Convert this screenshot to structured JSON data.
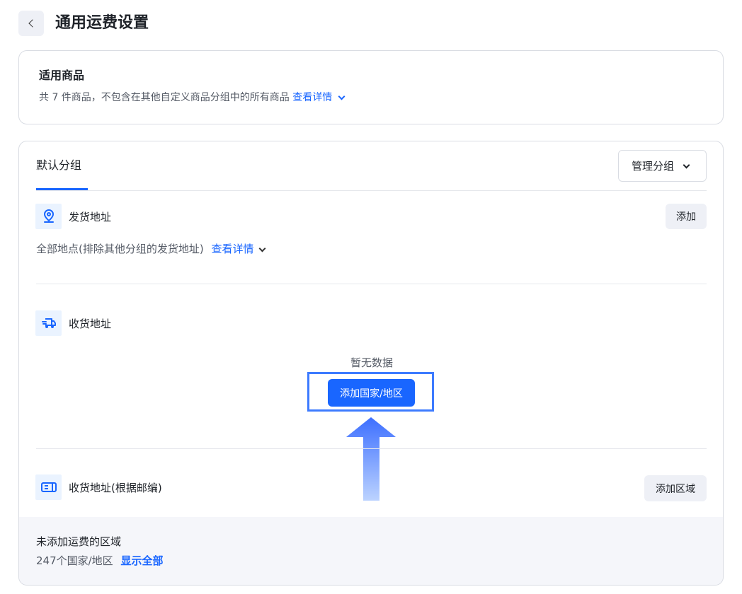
{
  "header": {
    "title": "通用运费设置"
  },
  "products": {
    "title": "适用商品",
    "description": "共 7 件商品，不包含在其他自定义商品分组中的所有商品",
    "details_link": "查看详情"
  },
  "group": {
    "tab": "默认分组",
    "manage_button": "管理分组",
    "ship_from": {
      "title": "发货地址",
      "add_button": "添加",
      "description": "全部地点(排除其他分组的发货地址)",
      "details_link": "查看详情"
    },
    "ship_to": {
      "title": "收货地址",
      "empty_text": "暂无数据",
      "add_button": "添加国家/地区"
    },
    "ship_to_zip": {
      "title": "收货地址(根据邮编)",
      "add_button": "添加区域"
    },
    "unassigned": {
      "title": "未添加运费的区域",
      "count_text": "247个国家/地区",
      "show_all": "显示全部"
    }
  },
  "colors": {
    "accent": "#1966ff",
    "highlight": "#3d7bff"
  }
}
